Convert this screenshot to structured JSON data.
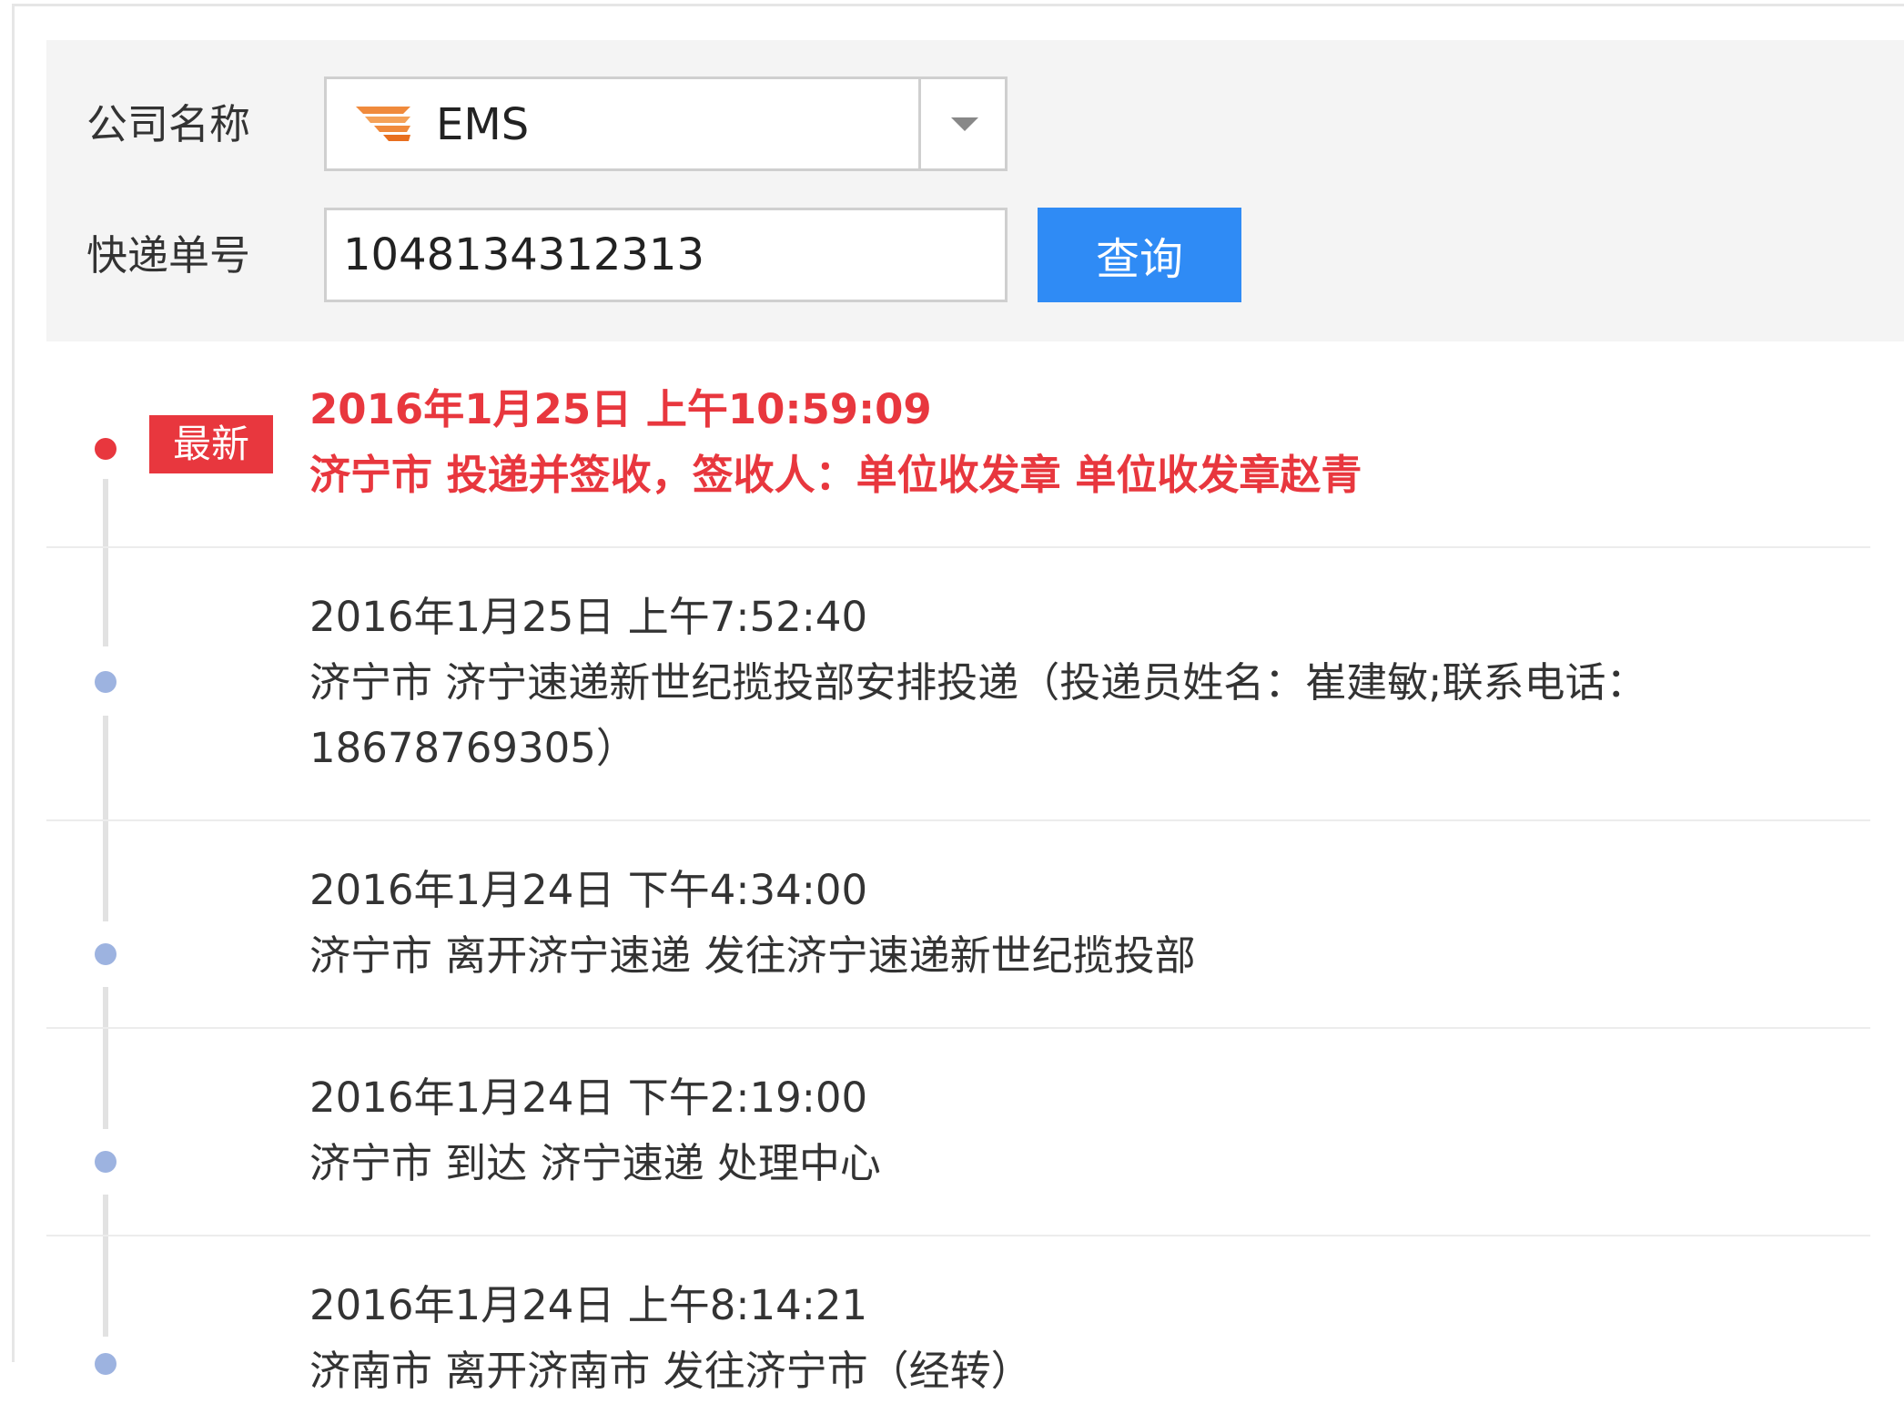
{
  "form": {
    "company_label": "公司名称",
    "company_value": "EMS",
    "company_logo_icon": "ems-logo-icon",
    "tracking_label": "快递单号",
    "tracking_value": "1048134312313",
    "query_button_label": "查询"
  },
  "colors": {
    "accent_blue": "#2f8bf5",
    "latest_red": "#e8373e",
    "dot_blue": "#9db3e0",
    "panel_bg": "#f4f4f4"
  },
  "timeline": {
    "latest_badge": "最新",
    "events": [
      {
        "time": "2016年1月25日 上午10:59:09",
        "desc": "济宁市 投递并签收，签收人：单位收发章 单位收发章赵青"
      },
      {
        "time": "2016年1月25日 上午7:52:40",
        "desc": "济宁市 济宁速递新世纪揽投部安排投递（投递员姓名：崔建敏;联系电话：18678769305）"
      },
      {
        "time": "2016年1月24日 下午4:34:00",
        "desc": "济宁市 离开济宁速递 发往济宁速递新世纪揽投部"
      },
      {
        "time": "2016年1月24日 下午2:19:00",
        "desc": "济宁市 到达 济宁速递 处理中心"
      },
      {
        "time": "2016年1月24日 上午8:14:21",
        "desc": "济南市 离开济南市 发往济宁市（经转）"
      }
    ]
  }
}
